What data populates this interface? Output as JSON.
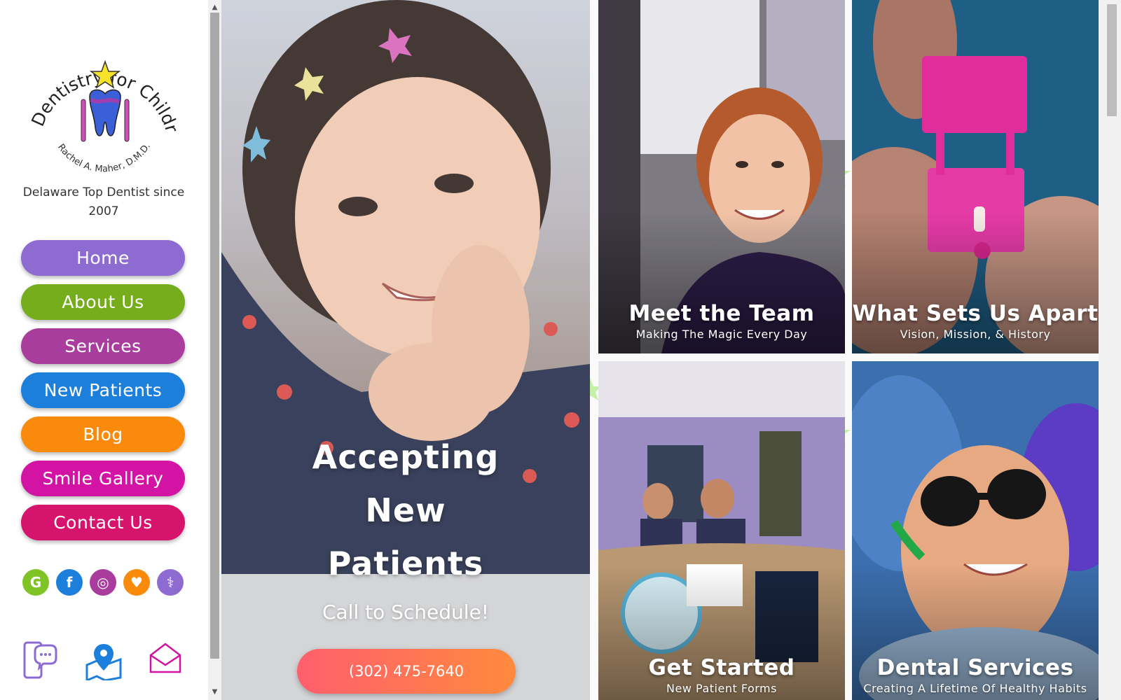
{
  "logo": {
    "arc_text": "Dentistry for Children",
    "doctor": "Rachel A. Maher, D.M.D."
  },
  "tagline": "Delaware Top Dentist since 2007",
  "nav": [
    {
      "label": "Home",
      "color": "#8e6bd1"
    },
    {
      "label": "About Us",
      "color": "#76ad1d"
    },
    {
      "label": "Services",
      "color": "#a93d9d"
    },
    {
      "label": "New Patients",
      "color": "#1d7fdc"
    },
    {
      "label": "Blog",
      "color": "#f98a0c"
    },
    {
      "label": "Smile Gallery",
      "color": "#d313a4"
    },
    {
      "label": "Contact Us",
      "color": "#d6146e"
    }
  ],
  "socials": [
    {
      "icon": "google-icon",
      "glyph": "G",
      "color": "#7fc424"
    },
    {
      "icon": "facebook-icon",
      "glyph": "f",
      "color": "#1d7fdc"
    },
    {
      "icon": "instagram-icon",
      "glyph": "◎",
      "color": "#a93d9d"
    },
    {
      "icon": "heart-review-icon",
      "glyph": "♥",
      "color": "#f98a0c"
    },
    {
      "icon": "stethoscope-icon",
      "glyph": "⚕",
      "color": "#8e6bd1"
    }
  ],
  "contact_icons": [
    "phone-chat-icon",
    "map-pin-icon",
    "envelope-icon"
  ],
  "hero": {
    "title_lines": [
      "Accepting",
      "New",
      "Patients"
    ],
    "subtitle": "Call to Schedule!",
    "phone": "(302) 475-7640"
  },
  "tiles": [
    {
      "title": "Meet the Team",
      "subtitle": "Making The Magic Every Day"
    },
    {
      "title": "What Sets Us Apart",
      "subtitle": "Vision, Mission, & History"
    },
    {
      "title": "Get Started",
      "subtitle": "New Patient Forms"
    },
    {
      "title": "Dental Services",
      "subtitle": "Creating A Lifetime Of Healthy Habits"
    }
  ]
}
